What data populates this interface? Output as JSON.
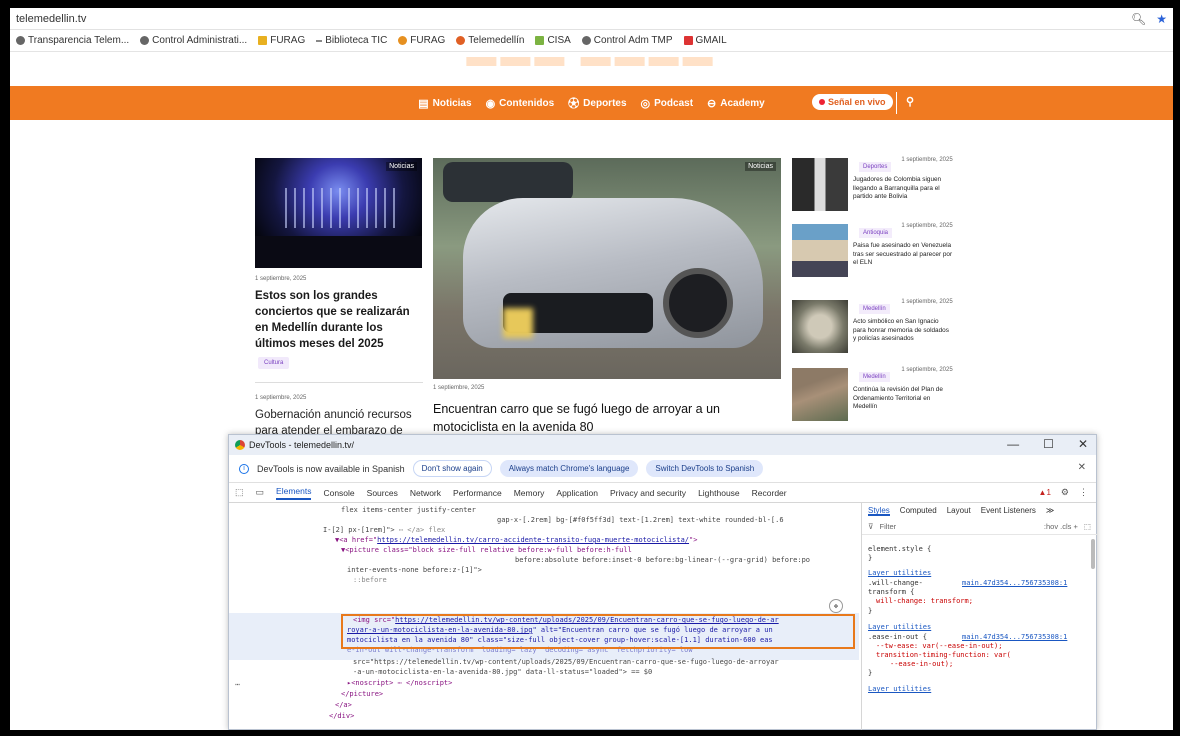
{
  "browser": {
    "url": "telemedellin.tv",
    "bookmarks": [
      {
        "label": "Transparencia Telem...",
        "icon": "globe-icon"
      },
      {
        "label": "Control Administrati...",
        "icon": "globe-icon"
      },
      {
        "label": "FURAG",
        "icon": "folder-icon"
      },
      {
        "label": "Biblioteca TIC",
        "icon": "dash-icon"
      },
      {
        "label": "FURAG",
        "icon": "key-icon"
      },
      {
        "label": "Telemedellín",
        "icon": "tm-icon"
      },
      {
        "label": "CISA",
        "icon": "cisa-icon"
      },
      {
        "label": "Control Adm TMP",
        "icon": "globe-icon"
      },
      {
        "label": "GMAIL",
        "icon": "gmail-icon"
      }
    ]
  },
  "site": {
    "nav": [
      "Noticias",
      "Contenidos",
      "Deportes",
      "Podcast",
      "Academy"
    ],
    "live_label": "Señal en vivo",
    "left_card": {
      "tag": "Noticias",
      "date": "1 septiembre, 2025",
      "title": "Estos son los grandes conciertos que se realizarán en Medellín durante los últimos meses del 2025",
      "category": "Cultura"
    },
    "left_card2": {
      "date": "1 septiembre, 2025",
      "title": "Gobernación anunció recursos para atender el embarazo de"
    },
    "main_card": {
      "tag": "Noticias",
      "date": "1 septiembre, 2025",
      "title": "Encuentran carro que se fugó luego de arroyar a un motociclista en la avenida 80"
    },
    "side": [
      {
        "category": "Deportes",
        "date": "1 septiembre, 2025",
        "title": "Jugadores de Colombia siguen llegando a Barranquilla para el partido ante Bolivia"
      },
      {
        "category": "Antioquia",
        "date": "1 septiembre, 2025",
        "title": "Paisa fue asesinado en Venezuela tras ser secuestrado al parecer por el ELN"
      },
      {
        "category": "Medellín",
        "date": "1 septiembre, 2025",
        "title": "Acto simbólico en San Ignacio para honrar memoria de soldados y policías asesinados"
      },
      {
        "category": "Medellín",
        "date": "1 septiembre, 2025",
        "title": "Continúa la revisión del Plan de Ordenamiento Territorial en Medellín"
      }
    ]
  },
  "devtools": {
    "title": "DevTools - telemedellin.tv/",
    "banner_text": "DevTools is now available in Spanish",
    "btn_dont_show": "Don't show again",
    "btn_match": "Always match Chrome's language",
    "btn_switch": "Switch DevTools to Spanish",
    "tabs": [
      "Elements",
      "Console",
      "Sources",
      "Network",
      "Performance",
      "Memory",
      "Application",
      "Privacy and security",
      "Lighthouse",
      "Recorder"
    ],
    "warn_count": "1",
    "style_tabs": [
      "Styles",
      "Computed",
      "Layout",
      "Event Listeners",
      "≫"
    ],
    "filter_placeholder": "Filter",
    "filter_tools": ":hov  .cls  +",
    "code": {
      "l1": "flex items-center justify-center",
      "l2": "gap-x-[.2rem] bg-[#f0f5ff3d] text-[1.2rem] text-white rounded-bl-[.6",
      "l3a": "I-[2] px-[1rem]\">",
      "l3b": "⋯ </a>",
      "l3c": "flex",
      "l4a": "▼<a href=\"",
      "l4b": "https://telemedellin.tv/carro-accidente-transito-fuga-muerte-motociclista/",
      "l4c": "\">",
      "l5a": "▼<picture class=\"block size-full relative before:w-full before:h-full",
      "l6": "before:absolute before:inset-0 before:bg-linear-(--gra-grid) before:po",
      "l7": "inter-events-none before:z-[1]\">",
      "l8": "::before",
      "l9a": "<img src=\"",
      "l9b": "https://telemedellin.tv/wp-content/uploads/2025/09/Encuentran-carro-que-se-fugo-luego-de-ar",
      "l10a": "royar-a-un-motociclista-en-la-avenida-80.jpg",
      "l10b": "\" alt=\"Encuentran carro que se fugó luego de arroyar a un",
      "l11": "motociclista en la avenida 80\" class=\"size-full object-cover group-hover:scale-[1.1] duration-600 eas",
      "l12": "e-in-out will-change-transform\" loading=\"lazy\" decoding=\"async\" fetchpriority=\"low\"",
      "l13": "src=\"https://telemedellin.tv/wp-content/uploads/2025/09/Encuentran-carro-que-se-fugo-luego-de-arroyar",
      "l14": "-a-un-motociclista-en-la-avenida-80.jpg\" data-ll-status=\"loaded\"> == $0",
      "l15": "▸<noscript> ⋯ </noscript>",
      "l16": "</picture>",
      "l17": "</a>",
      "l18": "</div>"
    },
    "styles": {
      "element_style": "element.style {",
      "close": "}",
      "layer1": "Layer utilities",
      "rule1a": ".will-change-",
      "rule1b": "transform {",
      "rule1_src": "main.47d354...756735308:1",
      "rule1_prop": "will-change: transform;",
      "layer2": "Layer utilities",
      "rule2": ".ease-in-out {",
      "rule2_src": "main.47d354...756735308:1",
      "rule2_p1": "--tw-ease: var(--ease-in-out);",
      "rule2_p2": "transition-timing-function: var(",
      "rule2_p3": "--ease-in-out);",
      "layer3": "Layer utilities"
    }
  }
}
